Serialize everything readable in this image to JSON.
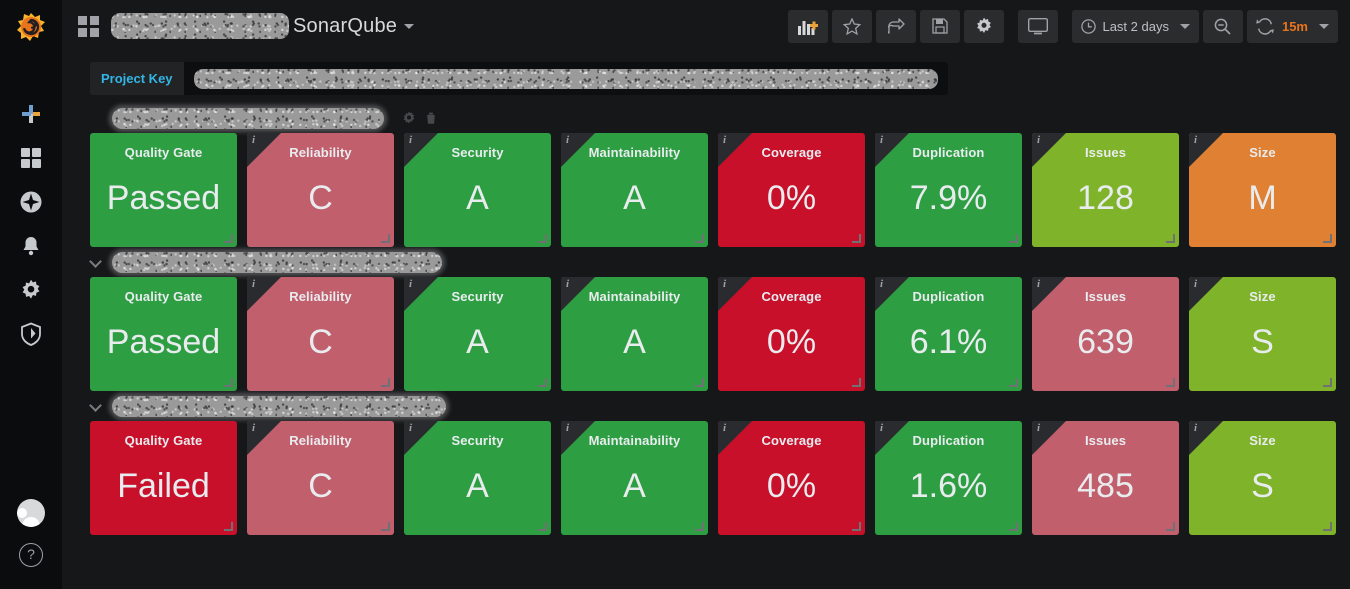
{
  "sidebar": {
    "logo": "grafana-logo",
    "items": [
      {
        "name": "create",
        "icon": "plus-icon"
      },
      {
        "name": "dashboards",
        "icon": "dashboards-icon"
      },
      {
        "name": "explore",
        "icon": "compass-icon"
      },
      {
        "name": "alerting",
        "icon": "bell-icon"
      },
      {
        "name": "configuration",
        "icon": "gear-icon"
      },
      {
        "name": "server-admin",
        "icon": "shield-icon"
      }
    ],
    "profile": {
      "icon": "user-avatar"
    },
    "help": {
      "label": "?",
      "icon": "help-icon"
    }
  },
  "topbar": {
    "menu_icon": "grid-icon",
    "title_redacted": true,
    "title": "SonarQube",
    "title_caret": "chevron-down-icon",
    "buttons": [
      {
        "name": "add-panel-button",
        "icon": "add-panel-icon"
      },
      {
        "name": "favorite-button",
        "icon": "star-icon"
      },
      {
        "name": "share-button",
        "icon": "share-icon"
      },
      {
        "name": "save-button",
        "icon": "save-icon"
      },
      {
        "name": "settings-button",
        "icon": "gear-icon"
      },
      {
        "name": "kiosk-button",
        "icon": "monitor-icon"
      }
    ],
    "time_picker": {
      "icon": "clock-icon",
      "label": "Last 2 days",
      "caret": "chevron-down-icon"
    },
    "zoom_out": {
      "icon": "search-minus-icon"
    },
    "refresh": {
      "icon": "refresh-icon",
      "interval": "15m",
      "caret": "chevron-down-icon",
      "accent_color": "#e8741d"
    }
  },
  "variables": {
    "project_key": {
      "label": "Project Key",
      "label_color": "#33b5e5",
      "value_redacted": true,
      "value_width": 744
    }
  },
  "rows": [
    {
      "name": "row-1",
      "title_redacted": true,
      "title_width": 272,
      "collapsed": false,
      "has_chevron": false,
      "actions": [
        {
          "name": "row-settings",
          "icon": "gear-icon"
        },
        {
          "name": "row-delete",
          "icon": "trash-icon"
        }
      ],
      "panels": [
        {
          "title": "Quality Gate",
          "value": "Passed",
          "color": "#2e9e43",
          "info": false
        },
        {
          "title": "Reliability",
          "value": "C",
          "color": "#c15f6d",
          "info": true
        },
        {
          "title": "Security",
          "value": "A",
          "color": "#2e9e43",
          "info": true
        },
        {
          "title": "Maintainability",
          "value": "A",
          "color": "#2e9e43",
          "info": true
        },
        {
          "title": "Coverage",
          "value": "0%",
          "color": "#c9102a",
          "info": true
        },
        {
          "title": "Duplication",
          "value": "7.9%",
          "color": "#2e9e43",
          "info": true
        },
        {
          "title": "Issues",
          "value": "128",
          "color": "#7fb329",
          "info": true
        },
        {
          "title": "Size",
          "value": "M",
          "color": "#df8033",
          "info": true
        }
      ]
    },
    {
      "name": "row-2",
      "title_redacted": true,
      "title_width": 330,
      "collapsed": false,
      "has_chevron": true,
      "actions": [],
      "panels": [
        {
          "title": "Quality Gate",
          "value": "Passed",
          "color": "#2e9e43",
          "info": false
        },
        {
          "title": "Reliability",
          "value": "C",
          "color": "#c15f6d",
          "info": true
        },
        {
          "title": "Security",
          "value": "A",
          "color": "#2e9e43",
          "info": true
        },
        {
          "title": "Maintainability",
          "value": "A",
          "color": "#2e9e43",
          "info": true
        },
        {
          "title": "Coverage",
          "value": "0%",
          "color": "#c9102a",
          "info": true
        },
        {
          "title": "Duplication",
          "value": "6.1%",
          "color": "#2e9e43",
          "info": true
        },
        {
          "title": "Issues",
          "value": "639",
          "color": "#c15f6d",
          "info": true
        },
        {
          "title": "Size",
          "value": "S",
          "color": "#7fb329",
          "info": true
        }
      ]
    },
    {
      "name": "row-3",
      "title_redacted": true,
      "title_width": 334,
      "collapsed": false,
      "has_chevron": true,
      "actions": [],
      "panels": [
        {
          "title": "Quality Gate",
          "value": "Failed",
          "color": "#c9102a",
          "info": false
        },
        {
          "title": "Reliability",
          "value": "C",
          "color": "#c15f6d",
          "info": true
        },
        {
          "title": "Security",
          "value": "A",
          "color": "#2e9e43",
          "info": true
        },
        {
          "title": "Maintainability",
          "value": "A",
          "color": "#2e9e43",
          "info": true
        },
        {
          "title": "Coverage",
          "value": "0%",
          "color": "#c9102a",
          "info": true
        },
        {
          "title": "Duplication",
          "value": "1.6%",
          "color": "#2e9e43",
          "info": true
        },
        {
          "title": "Issues",
          "value": "485",
          "color": "#c15f6d",
          "info": true
        },
        {
          "title": "Size",
          "value": "S",
          "color": "#7fb329",
          "info": true
        }
      ]
    }
  ]
}
